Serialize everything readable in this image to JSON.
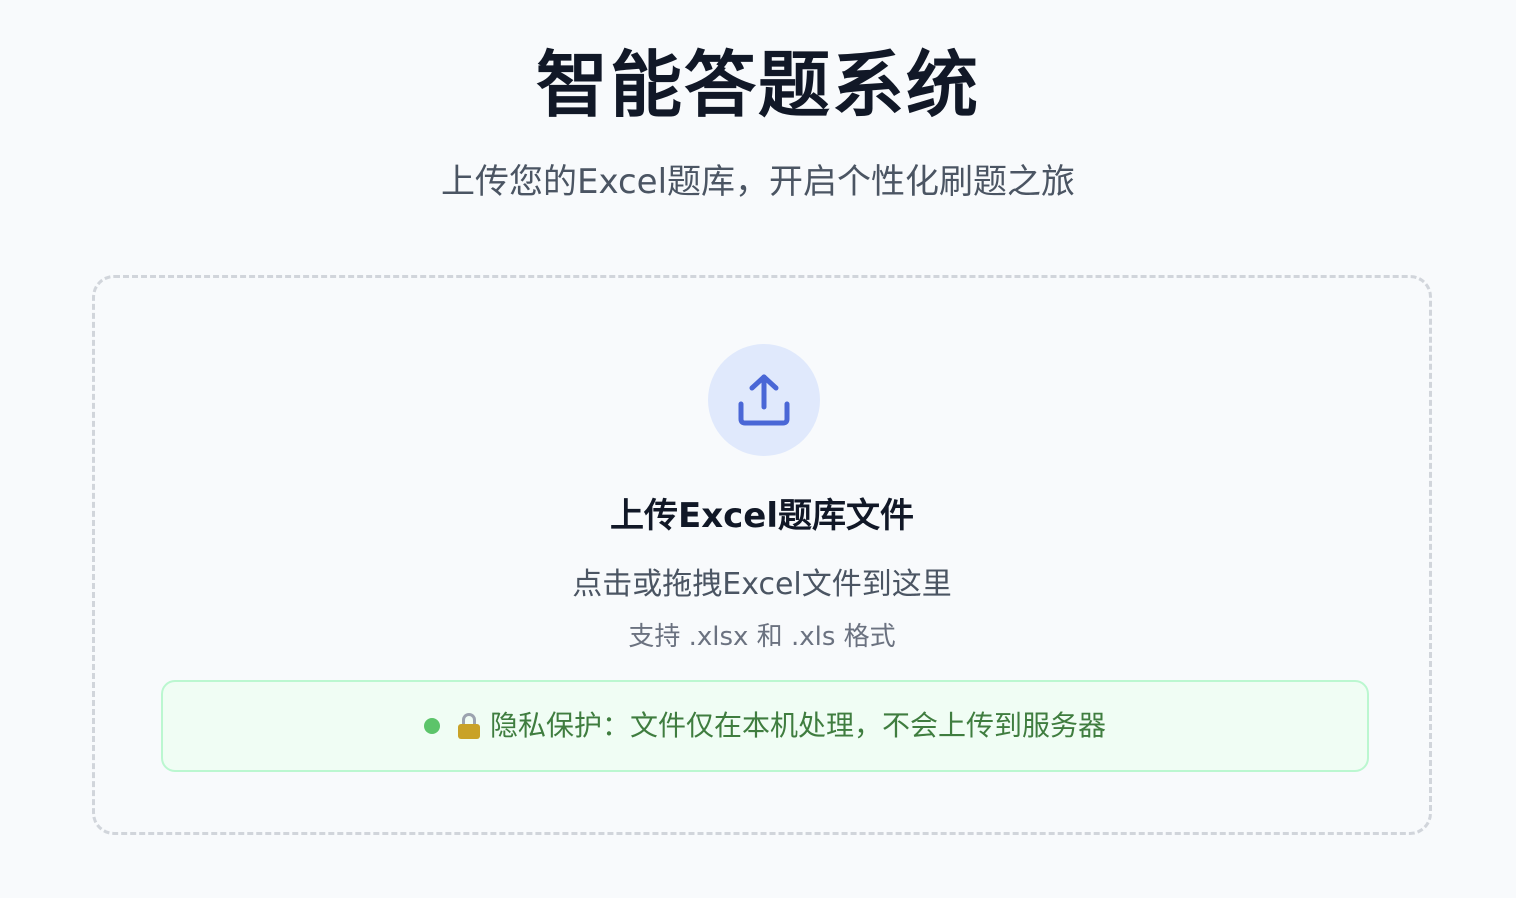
{
  "header": {
    "title": "智能答题系统",
    "subtitle": "上传您的Excel题库，开启个性化刷题之旅"
  },
  "upload": {
    "icon": "upload-icon",
    "title": "上传Excel题库文件",
    "hint": "点击或拖拽Excel文件到这里",
    "formats": "支持 .xlsx 和 .xls 格式"
  },
  "privacy": {
    "icon": "lock-icon",
    "text": "隐私保护：文件仅在本机处理，不会上传到服务器"
  },
  "colors": {
    "accent": "#4a67d6",
    "upload_circle_bg": "#e0e9fc",
    "privacy_bg": "#f0fdf4",
    "privacy_text": "#3f7d3f",
    "status_dot": "#5cc46a"
  }
}
